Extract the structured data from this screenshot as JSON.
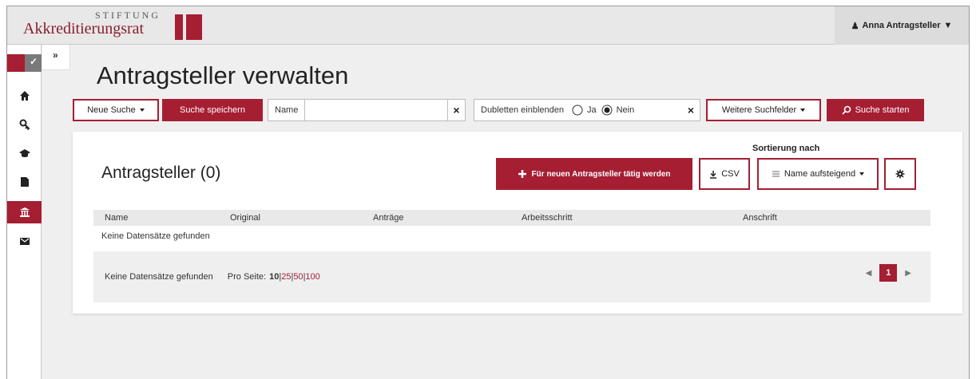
{
  "header": {
    "logo_top": "STIFTUNG",
    "logo_main": "Akkreditierungsrat",
    "user_name": "Anna Antragsteller"
  },
  "sidebar": {
    "expand_label": "»",
    "items": [
      {
        "icon": "home-icon"
      },
      {
        "icon": "key-icon"
      },
      {
        "icon": "graduation-cap-icon"
      },
      {
        "icon": "file-icon"
      },
      {
        "icon": "institution-icon",
        "active": true
      },
      {
        "icon": "envelope-icon"
      }
    ]
  },
  "page": {
    "title": "Antragsteller verwalten"
  },
  "search": {
    "new_search": "Neue Suche",
    "save_search": "Suche speichern",
    "name_label": "Name",
    "name_value": "",
    "name_placeholder": "",
    "clear": "×",
    "duplicates_label": "Dubletten einblenden",
    "yes": "Ja",
    "no": "Nein",
    "duplicates_selected": "Nein",
    "more_fields": "Weitere Suchfelder",
    "start": "Suche starten"
  },
  "card": {
    "title": "Antragsteller (0)",
    "new_button": "Für neuen Antragsteller tätig werden",
    "csv": "CSV",
    "sort_label": "Sortierung nach",
    "sort_value": "Name aufsteigend",
    "columns": [
      "Name",
      "Original",
      "Anträge",
      "Arbeitsschritt",
      "Anschrift"
    ],
    "empty_text": "Keine Datensätze gefunden"
  },
  "footer": {
    "no_records": "Keine Datensätze gefunden",
    "per_page_label": "Pro Seite:",
    "per_page_options": [
      "10",
      "25",
      "50",
      "100"
    ],
    "per_page_selected": "10",
    "current_page": "1"
  },
  "colors": {
    "accent": "#a51e32"
  }
}
